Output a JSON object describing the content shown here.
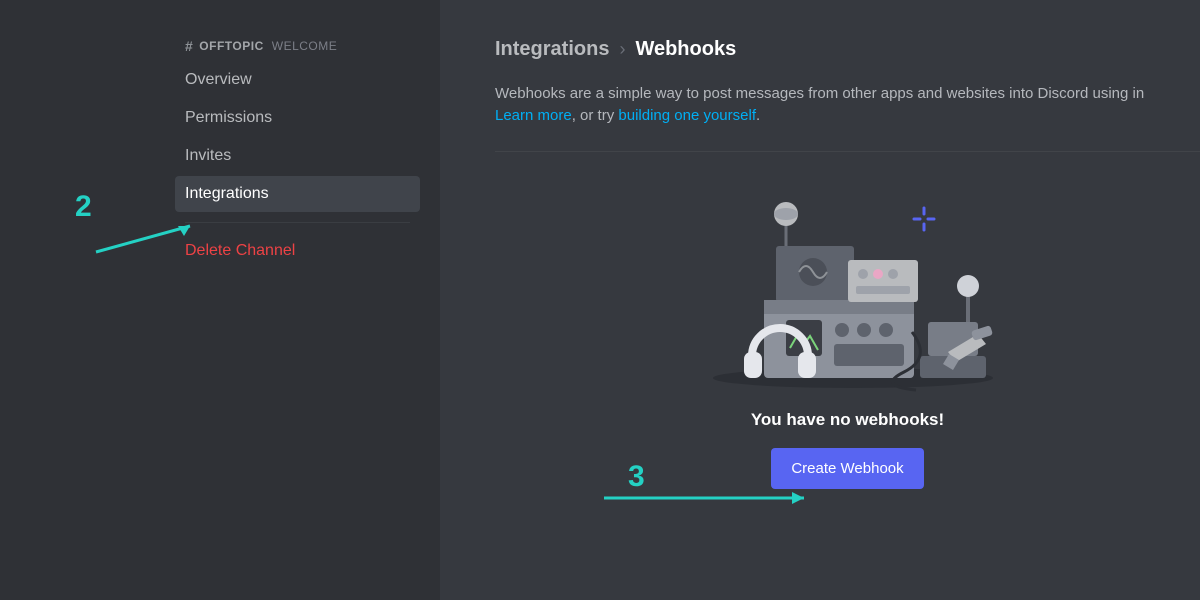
{
  "sidebar": {
    "hash": "#",
    "channel_name": "OFFTOPIC",
    "welcome": "WELCOME",
    "items": {
      "overview": "Overview",
      "permissions": "Permissions",
      "invites": "Invites",
      "integrations": "Integrations"
    },
    "delete_label": "Delete Channel"
  },
  "main": {
    "breadcrumb_parent": "Integrations",
    "breadcrumb_sep": "›",
    "breadcrumb_current": "Webhooks",
    "desc_1": "Webhooks are a simple way to post messages from other apps and websites into Discord using in",
    "learn_more": "Learn more",
    "desc_2": ", or try ",
    "build_yourself": "building one yourself",
    "desc_3": ".",
    "empty_title": "You have no webhooks!",
    "create_button": "Create Webhook"
  },
  "annotations": {
    "two": "2",
    "three": "3"
  }
}
